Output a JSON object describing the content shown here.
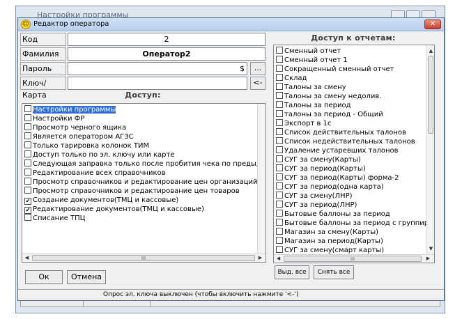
{
  "background_window": {
    "title": "Настройки программы"
  },
  "dialog": {
    "title": "Редактор оператора",
    "close_label": "✕"
  },
  "form": {
    "code_label": "Код",
    "code_value": "2",
    "surname_label": "Фамилия",
    "surname_value": "Оператор2",
    "password_label": "Пароль",
    "password_value": "$",
    "password_button": "...",
    "key_label": "Ключ/Карта",
    "key_value": "",
    "key_button": "<-"
  },
  "access": {
    "title": "Доступ:",
    "items": [
      {
        "label": "Настройки программы",
        "checked": false,
        "selected": true
      },
      {
        "label": "Настройки ФР",
        "checked": false
      },
      {
        "label": "Просмотр черного ящика",
        "checked": false
      },
      {
        "label": "Является оператором АГЗС",
        "checked": false
      },
      {
        "label": "Только тарировка колонок ТИМ",
        "checked": false
      },
      {
        "label": "Доступ только по эл. ключу или карте",
        "checked": false
      },
      {
        "label": "Следующая заправка только после пробития чека по предыдущей",
        "checked": false
      },
      {
        "label": "Редактирование всех справочников",
        "checked": false
      },
      {
        "label": "Просмотр справочников и редактирование цен организаций",
        "checked": false
      },
      {
        "label": "Просмотр справочников и редактирование цен товаров",
        "checked": false
      },
      {
        "label": "Создание документов(ТМЦ и кассовые)",
        "checked": true
      },
      {
        "label": "Редактирование документов(ТМЦ и кассовые)",
        "checked": true
      },
      {
        "label": "Списание ТПЦ",
        "checked": false
      }
    ],
    "scroll_mark": "III"
  },
  "reports": {
    "title": "Доступ к отчетам:",
    "items": [
      {
        "label": "Сменный отчет",
        "checked": false
      },
      {
        "label": "Сменный отчет 1",
        "checked": false
      },
      {
        "label": "Сокращенный сменный отчет",
        "checked": false
      },
      {
        "label": "Склад",
        "checked": false
      },
      {
        "label": "Талоны за смену",
        "checked": false
      },
      {
        "label": "Талоны за смену недолив.",
        "checked": false
      },
      {
        "label": "Талоны за период",
        "checked": false
      },
      {
        "label": "талоны за период - Общий",
        "checked": false
      },
      {
        "label": "Экспорт в 1с",
        "checked": false
      },
      {
        "label": "Список действительных талонов",
        "checked": false
      },
      {
        "label": "Список недействительных талонов",
        "checked": false
      },
      {
        "label": "Удаление устаревших талонов",
        "checked": false
      },
      {
        "label": "СУГ за смену(Карты)",
        "checked": false
      },
      {
        "label": "СУГ за период(Карты)",
        "checked": false
      },
      {
        "label": "СУГ за период(Карты) форма-2",
        "checked": false
      },
      {
        "label": "СУГ за период(одна карта)",
        "checked": false
      },
      {
        "label": "СУГ за смену(ЛНР)",
        "checked": false
      },
      {
        "label": "СУГ за период(ЛНР)",
        "checked": false
      },
      {
        "label": "Бытовые баллоны за период",
        "checked": false
      },
      {
        "label": "Бытовые баллоны за период с группиро",
        "checked": false
      },
      {
        "label": "Магазин за смену(Карты)",
        "checked": false
      },
      {
        "label": "Магазин за период(Карты)",
        "checked": false
      },
      {
        "label": "СУГ за смену(смарт карты)",
        "checked": false
      }
    ],
    "scroll_mark": "III",
    "select_all": "Выд. все",
    "deselect_all": "Снять все"
  },
  "buttons": {
    "ok": "Ок",
    "cancel": "Отмена"
  },
  "status": {
    "text": "Опрос эл. ключа выключен (чтобы включить нажмите '<-')"
  }
}
